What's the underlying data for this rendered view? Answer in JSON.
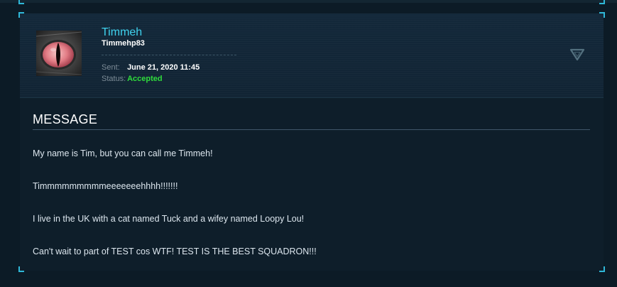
{
  "sender": {
    "display_name": "Timmeh",
    "handle": "Timmehp83",
    "avatar": "red-cat-eye-avatar"
  },
  "meta": {
    "sent_label": "Sent:",
    "sent_value": "June 21, 2020 11:45",
    "status_label": "Status:",
    "status_value": "Accepted"
  },
  "controls": {
    "collapse_icon": "triangle-down-icon"
  },
  "message": {
    "heading": "MESSAGE",
    "paragraphs": [
      "My name is Tim, but you can call me Timmeh!",
      "Timmmmmmmmmeeeeeeehhhh!!!!!!!",
      "I live in the UK with a cat named Tuck and a wifey named Loopy Lou!",
      "Can't wait to part of TEST cos WTF! TEST IS THE BEST SQUADRON!!!"
    ]
  },
  "colors": {
    "accent": "#33c3e0",
    "name": "#3fd2ee",
    "status_accepted": "#2fdc3c",
    "background": "#0e1e2a"
  }
}
